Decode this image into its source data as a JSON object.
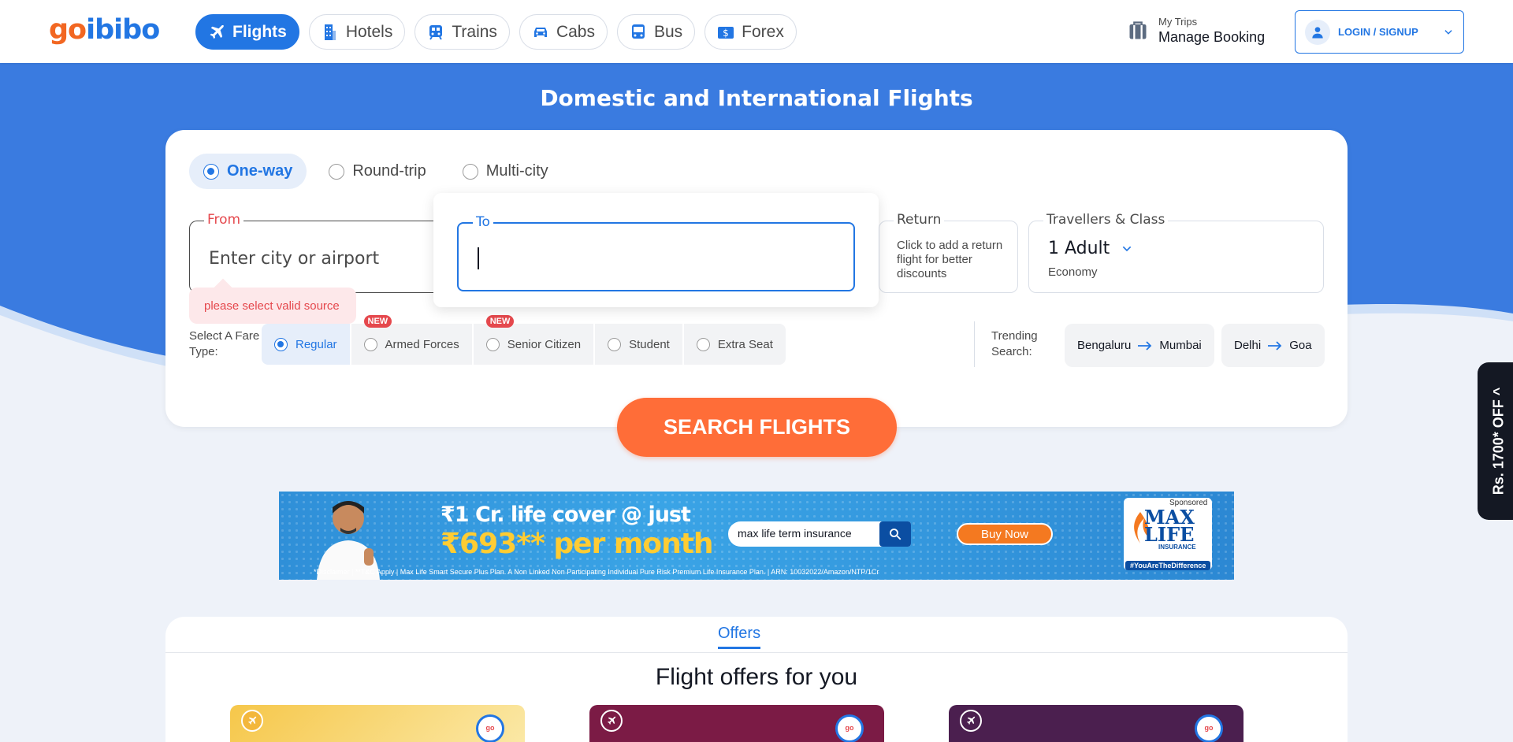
{
  "brand": {
    "logo_go": "go",
    "logo_ibibo": "ibibo"
  },
  "nav": [
    {
      "label": "Flights",
      "icon": "plane-icon",
      "active": true
    },
    {
      "label": "Hotels",
      "icon": "building-icon"
    },
    {
      "label": "Trains",
      "icon": "train-icon"
    },
    {
      "label": "Cabs",
      "icon": "car-icon"
    },
    {
      "label": "Bus",
      "icon": "bus-icon"
    },
    {
      "label": "Forex",
      "icon": "forex-icon"
    }
  ],
  "trips": {
    "small": "My Trips",
    "big": "Manage Booking",
    "icon": "briefcase-icon"
  },
  "login": {
    "label": "LOGIN / SIGNUP",
    "icon": "user-icon"
  },
  "hero": {
    "title": "Domestic and International Flights"
  },
  "trip_types": [
    {
      "label": "One-way",
      "selected": true
    },
    {
      "label": "Round-trip"
    },
    {
      "label": "Multi-city"
    }
  ],
  "from": {
    "label": "From",
    "placeholder": "Enter city or airport",
    "error": "please select valid source"
  },
  "to": {
    "label": "To",
    "value": ""
  },
  "return": {
    "label": "Return",
    "hint": "Click to add a return flight for better discounts"
  },
  "travellers": {
    "label": "Travellers & Class",
    "value": "1 Adult",
    "class": "Economy"
  },
  "fare": {
    "label": "Select A Fare Type:",
    "options": [
      {
        "label": "Regular",
        "selected": true
      },
      {
        "label": "Armed Forces",
        "badge": "NEW"
      },
      {
        "label": "Senior Citizen",
        "badge": "NEW"
      },
      {
        "label": "Student"
      },
      {
        "label": "Extra Seat"
      }
    ]
  },
  "trending": {
    "label": "Trending Search:",
    "routes": [
      {
        "from": "Bengaluru",
        "to": "Mumbai"
      },
      {
        "from": "Delhi",
        "to": "Goa"
      }
    ]
  },
  "search_button": "SEARCH FLIGHTS",
  "side_offer": "Rs. 1700* OFF ^",
  "ad": {
    "line1": "₹1 Cr. life cover @ just",
    "line2": "₹693** per month",
    "search_text": "max life term insurance",
    "buy": "Buy Now",
    "brand_name": "MAX LIFE",
    "brand_sub": "INSURANCE",
    "sponsored": "Sponsored",
    "tagline": "#YouAreTheDifference",
    "disclaimer": "*Disclaimer | **T&C Apply | Max Life Smart Secure Plus Plan. A Non Linked Non Participating Individual Pure Risk Premium Life Insurance Plan. | ARN: 10032022/Amazon/NTP/1Cr"
  },
  "offers": {
    "tab": "Offers",
    "heading": "Flight offers for you",
    "card_colors": [
      "#f6c74a",
      "#7b1b45",
      "#4b1f4f"
    ],
    "safe_label": "go Safe"
  },
  "colors": {
    "primary": "#2276e3",
    "accent": "#ff6d38",
    "error": "#e5484d",
    "logo_orange": "#f26722"
  }
}
